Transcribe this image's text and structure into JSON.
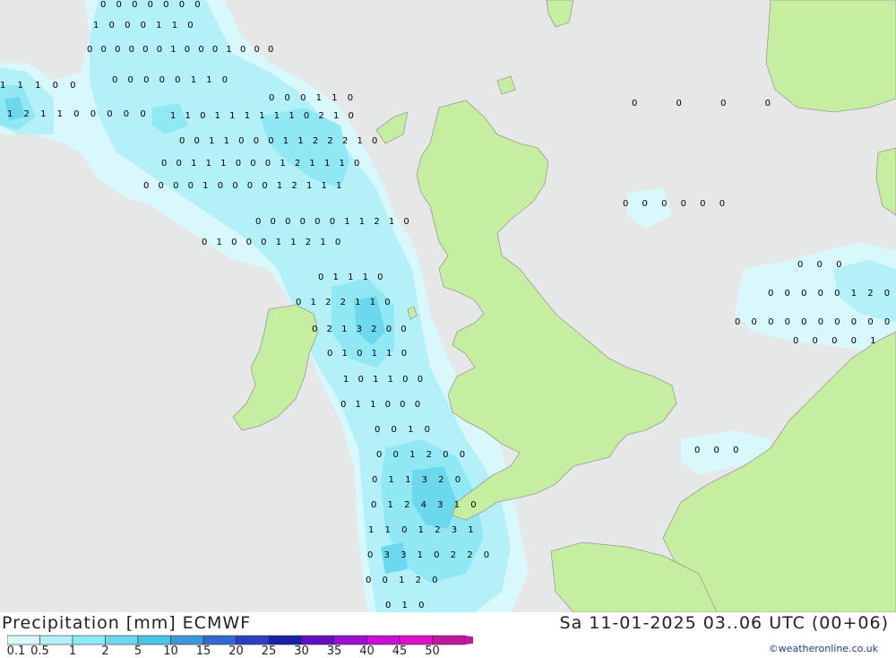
{
  "header": {
    "title": "Precipitation [mm] ECMWF",
    "validity": "Sa 11-01-2025 03..06 UTC (00+06)",
    "copyright": "©weatheronline.co.uk"
  },
  "legend": {
    "labels": [
      "0.1",
      "0.5",
      "1",
      "2",
      "5",
      "10",
      "15",
      "20",
      "25",
      "30",
      "35",
      "40",
      "45",
      "50"
    ],
    "colors": [
      "#d8f8fc",
      "#b4f0f8",
      "#90e8f4",
      "#6cd8ec",
      "#48c4e4",
      "#3c96d8",
      "#3468d0",
      "#2c40c4",
      "#1c20a8",
      "#6010c0",
      "#9c10d4",
      "#c810d8",
      "#e010c8",
      "#c0189c"
    ]
  },
  "colors": {
    "sea": "#e6e8e8",
    "land": "#c6eea0",
    "border": "#9a9a9a",
    "precip_light": "#d8f8fc",
    "precip_mid": "#b4f0f8",
    "precip_heavy": "#6cd8ec"
  },
  "grid_values": {
    "r01": "0 0 0 0 0 0 0",
    "r02": "1 0 0 0 1 1 0",
    "r03": "0 0 0 0 0 0 1 0 0 0 1 0 0 0",
    "r04": "1 1 1 0 0",
    "r05": "0 0 0 0 0 1 1 0",
    "r06": "0 0 0 1 1 0",
    "r07": "1 2 1 1 0 0 0 0 0",
    "r08": "1 1 0 1 1 1 1 1 1 0 2 1 0",
    "r09": "0 0 1 1 0 0 0 1 1 2 2 2 1 0",
    "r10": "0 0 1 1 1 0 0 0 1 2 1 1 1 0",
    "r11": "0 0 0 0 1 0 0 0 0 1 2 1 1 1",
    "r12": "0 0 0 0 0 0 1 1 2 1 0",
    "r13": "0 1 0 0 0 1 1 2 1 0",
    "r14": "0 1 1 1 0",
    "r15": "0 1 2 2 1 1 0",
    "r16": "0 2 1 3 2 0 0",
    "r17": "0 1 0 1 1 0",
    "r18": "1 0 1 1 0 0",
    "r19": "0 1 1 0 0 0",
    "r20": "0 0 1 0",
    "r21": "0 0 1 2 0 0",
    "r22": "0 1 1 3 2 0",
    "r23": "0 1 2 4 3 1 0",
    "r24": "1 1 0 1 2 3 1",
    "r25": "0 3 3 1 0 2 2 0",
    "r26": "0 0 1 2 0",
    "r27": "0 1 0",
    "east_a": "0 0 0 0",
    "east_b": "0 0 0 0 0 0",
    "east_c": "0 0 0 0 0 1 2 0",
    "east_d": "0 0 0 0 0 0 0 0 0 0",
    "east_e": "0 0 0 0 1",
    "east_f": "0 0 0",
    "east_g": "0 0 0"
  }
}
